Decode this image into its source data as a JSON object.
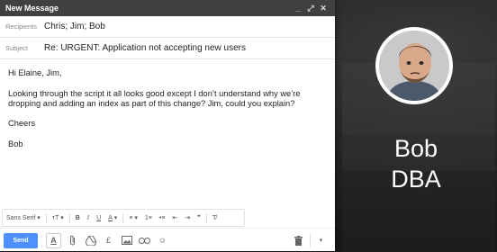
{
  "window": {
    "title": "New Message"
  },
  "fields": {
    "recipients_label": "Recipients",
    "recipients_value": "Chris; Jim; Bob",
    "subject_label": "Subject",
    "subject_value": "Re: URGENT: Application not accepting new users"
  },
  "message": {
    "greeting": "Hi Elaine, Jim,",
    "paragraph": "Looking through the script it all looks good except I don’t understand why we’re dropping and adding an index as part of this change? Jim, could you explain?",
    "signoff": "Cheers",
    "signature": "Bob"
  },
  "toolbar": {
    "font": "Sans Serif",
    "size": "ᴛT",
    "bold": "B",
    "italic": "I",
    "underline": "U",
    "color": "A",
    "align": "≡",
    "numbered": "1≡",
    "bulleted": "•≡",
    "indent_less": "⇤",
    "indent_more": "⇥",
    "quote": "❞",
    "clear": "T̸"
  },
  "actions": {
    "send_label": "Send"
  },
  "persona": {
    "name": "Bob",
    "role": "DBA"
  },
  "colors": {
    "title_bar": "#404040",
    "send": "#4d90fe"
  }
}
